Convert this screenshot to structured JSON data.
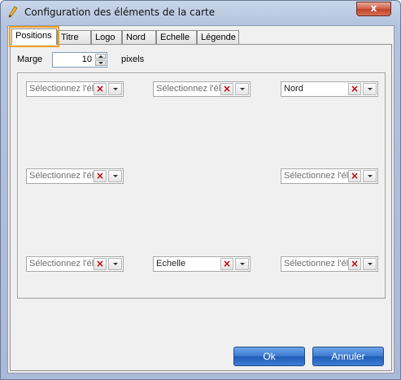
{
  "window": {
    "title": "Configuration des éléments de la carte",
    "close_label": "x"
  },
  "tabs": [
    {
      "label": "Positions",
      "active": true
    },
    {
      "label": "Titre",
      "active": false
    },
    {
      "label": "Logo",
      "active": false
    },
    {
      "label": "Nord",
      "active": false
    },
    {
      "label": "Echelle",
      "active": false
    },
    {
      "label": "Légende",
      "active": false
    }
  ],
  "margin": {
    "label": "Marge",
    "value": "10",
    "unit": "pixels"
  },
  "positions": [
    {
      "slot": "top-left",
      "text": "Sélectionnez l'él",
      "placeholder": true
    },
    {
      "slot": "top-center",
      "text": "Sélectionnez l'él",
      "placeholder": true
    },
    {
      "slot": "top-right",
      "text": "Nord",
      "placeholder": false
    },
    {
      "slot": "middle-left",
      "text": "Sélectionnez l'él",
      "placeholder": true
    },
    {
      "slot": "middle-right",
      "text": "Sélectionnez l'él",
      "placeholder": true
    },
    {
      "slot": "bottom-left",
      "text": "Sélectionnez l'él",
      "placeholder": true
    },
    {
      "slot": "bottom-center",
      "text": "Echelle",
      "placeholder": false
    },
    {
      "slot": "bottom-right",
      "text": "Sélectionnez l'él",
      "placeholder": true
    }
  ],
  "buttons": {
    "ok": "Ok",
    "cancel": "Annuler"
  },
  "colors": {
    "active_tab_highlight": "#f0a020",
    "clear_icon": "#c00000",
    "button_blue": "#3a78cf"
  },
  "icons": {
    "title": "pencil-icon",
    "clear": "clear-x-icon",
    "dropdown": "chevron-down-icon"
  }
}
